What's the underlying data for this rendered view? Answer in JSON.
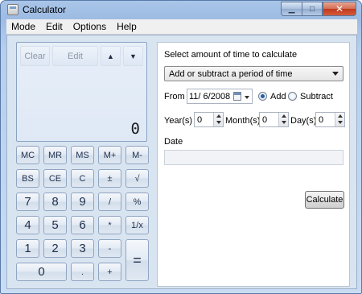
{
  "window": {
    "title": "Calculator",
    "min_glyph": "▁",
    "max_glyph": "□",
    "close_glyph": "✕"
  },
  "menu": [
    "Mode",
    "Edit",
    "Options",
    "Help"
  ],
  "display": {
    "clear": "Clear",
    "edit": "Edit",
    "up": "▲",
    "down": "▼",
    "value": "0"
  },
  "keys": {
    "mc": "MC",
    "mr": "MR",
    "ms": "MS",
    "mplus": "M+",
    "mminus": "M-",
    "bs": "BS",
    "ce": "CE",
    "c": "C",
    "pm": "±",
    "sqrt": "√",
    "k7": "7",
    "k8": "8",
    "k9": "9",
    "div": "/",
    "pct": "%",
    "k4": "4",
    "k5": "5",
    "k6": "6",
    "mul": "*",
    "recip": "1/x",
    "k1": "1",
    "k2": "2",
    "k3": "3",
    "sub": "-",
    "eq": "=",
    "k0": "0",
    "dot": ".",
    "add": "+"
  },
  "date_panel": {
    "heading": "Select amount of time to calculate",
    "mode_select": "Add or subtract a period of time",
    "from_label": "From",
    "from_date": "11/ 6/2008",
    "add_label": "Add",
    "subtract_label": "Subtract",
    "add_selected": true,
    "years_label": "Year(s)",
    "years_value": "0",
    "months_label": "Month(s)",
    "months_value": "0",
    "days_label": "Day(s)",
    "days_value": "0",
    "date_label": "Date",
    "result": "",
    "calculate_label": "Calculate"
  }
}
